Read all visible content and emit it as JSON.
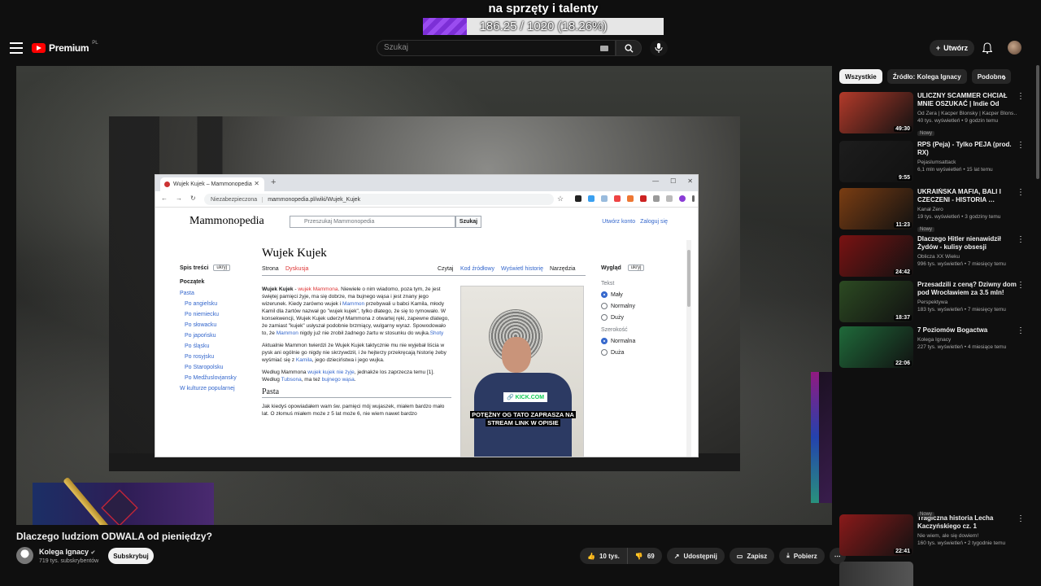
{
  "overlay": {
    "goal_title": "na sprzęty i talenty",
    "progress_text": "186.25 / 1020 (18.26%)",
    "progress_fraction": 0.1826,
    "accent": "#8c3be6"
  },
  "header": {
    "logo_text": "Premium",
    "logo_region": "PL",
    "search_placeholder": "Szukaj",
    "create_label": "Utwórz"
  },
  "browser": {
    "tab_title": "Wujek Kujek – Mammonopedia",
    "insecure_label": "Niezabezpieczona",
    "url": "mammonopedia.pl/wiki/Wujek_Kujek"
  },
  "wiki": {
    "logo": "Mammonopedia",
    "search_placeholder": "Przeszukaj Mammonopedia",
    "search_btn": "Szukaj",
    "create_account": "Utwórz konto",
    "login": "Zaloguj się",
    "toc_title": "Spis treści",
    "hide": "ukryj",
    "toc": [
      {
        "label": "Początek",
        "level": "top"
      },
      {
        "label": "Pasta",
        "level": "main"
      },
      {
        "label": "Po angielsku",
        "level": "sub"
      },
      {
        "label": "Po niemiecku",
        "level": "sub"
      },
      {
        "label": "Po słowacku",
        "level": "sub"
      },
      {
        "label": "Po japońsku",
        "level": "sub"
      },
      {
        "label": "Po śląsku",
        "level": "sub"
      },
      {
        "label": "Po rosyjsku",
        "level": "sub"
      },
      {
        "label": "Po Staropolsku",
        "level": "sub"
      },
      {
        "label": "Po Medžuslovjansky",
        "level": "sub"
      },
      {
        "label": "W kulturze popularnej",
        "level": "main"
      }
    ],
    "title": "Wujek Kujek",
    "tab_page": "Strona",
    "tab_discussion": "Dyskusja",
    "tab_read": "Czytaj",
    "tab_source": "Kod źródłowy",
    "tab_history": "Wyświetl historię",
    "tab_tools": "Narzędzia",
    "para1_a": "Wujek Kujek",
    "para1_b": " - ",
    "para1_c": "wujek Mammona",
    "para1_d": ". Niewiele o nim wiadomo, poza tym, że jest świętej pamięci żyje, ma się dobrze, ma bujnego wąsa i jest znany jego wizerunek. Kiedy zarówno wujek i ",
    "para1_e": "Mammon",
    "para1_f": " przebywali u babci Kamila, młody Kamil dla żartów nazwał go \"wujek kujek\", tylko dlatego, że się to rymowało. W konsekwencji, Wujek Kujek uderzył Mammona z otwartej ręki, zapewne dlatego, że zamiast \"kujek\" usłyszał podobnie brzmiący, wulgarny wyraz. Spowodowało to, że ",
    "para1_g": "Mammon",
    "para1_h": " nigdy już nie zrobił żadnego żartu w stosunku do wujka.",
    "para1_i": "Shoty",
    "para2": "Aktualnie Mammon twierdzi że Wujek Kujek taktycznie mu nie wyjebał liścia w pysk ani ogólnie go nigdy nie skrzywdził, i że hejterzy przekręcają historię żeby wyśmiać się z ",
    "para2_link": "Kamila",
    "para2_end": ", jego dzieciństwa i jego wujka.",
    "para3_a": "Według Mammona ",
    "para3_link": "wujek kujek nie żyje",
    "para3_b": ", jednakże los zaprzecza temu [1]. Według ",
    "para3_link2": "Tubsona",
    "para3_c": ", ma też ",
    "para3_link3": "bujnego wąsa",
    "para3_d": ".",
    "section_pasta": "Pasta",
    "pasta_text": "Jak kiedyś opowiadałem wam św. pamięci mój wujaszek, miałem bardzo mało lat. O złomuś miałem może z 5 lat może 6, nie wiem nawet bardzo",
    "img_tag": "KICK.COM",
    "img_promo_1": "POTĘŻNY OG TATO ZAPRASZA NA",
    "img_promo_2": "STREAM LINK W OPISIE",
    "appearance_title": "Wygląd",
    "text_label": "Tekst",
    "text_opts": [
      "Mały",
      "Normalny",
      "Duży"
    ],
    "width_label": "Szerokość",
    "width_opts": [
      "Normalna",
      "Duża"
    ]
  },
  "video": {
    "title": "Dlaczego ludziom ODWALA od pieniędzy?",
    "channel": "Kolega Ignacy",
    "subs": "719 tys. subskrybentów",
    "subscribe": "Subskrybuj",
    "likes": "10 tys.",
    "dislikes": "69",
    "share": "Udostępnij",
    "save": "Zapisz",
    "download": "Pobierz"
  },
  "chips": [
    "Wszystkie",
    "Źródło: Kolega Ignacy",
    "Podobne"
  ],
  "recommendations": [
    {
      "title": "ULICZNY SCAMMER CHCIAŁ MNIE OSZUKAĆ | Indie Od Zer…",
      "channel": "Od Zera | Kacper Blonsky | Kacper Blons…",
      "stats": "40 tys. wyświetleń • 9 godzin temu",
      "badge": "Nowy",
      "duration": "49:30",
      "color": "#b33a2a"
    },
    {
      "title": "RPS (Peja) - Tylko PEJA (prod. RX)",
      "channel": "Pejaslumsattack",
      "stats": "6,1 mln wyświetleń • 15 lat temu",
      "badge": "",
      "duration": "9:55",
      "color": "#1d1d1d"
    },
    {
      "title": "UKRAIŃSKA MAFIA, BALI I CZECZENI - HISTORIA …",
      "channel": "Kanał Zero",
      "stats": "19 tys. wyświetleń • 3 godziny temu",
      "badge": "Nowy",
      "duration": "11:23",
      "color": "#7a3d12"
    },
    {
      "title": "Dlaczego Hitler nienawidził Żydów - kulisy obsesji",
      "channel": "Oblicza XX Wieku",
      "stats": "996 tys. wyświetleń • 7 miesięcy temu",
      "badge": "",
      "duration": "24:42",
      "color": "#7a1212"
    },
    {
      "title": "Przesadzili z ceną? Dziwny dom pod Wrocławiem za 3.5 mln!",
      "channel": "Perspektywa",
      "stats": "183 tys. wyświetleń • 7 miesięcy temu",
      "badge": "",
      "duration": "18:37",
      "color": "#2c4a22"
    },
    {
      "title": "7 Poziomów Bogactwa",
      "channel": "Kolega Ignacy",
      "stats": "227 tys. wyświetleń • 4 miesiące temu",
      "badge": "",
      "duration": "22:06",
      "color": "#1f6a3a"
    },
    {
      "title": "Tragiczna historia Lecha Kaczyńskiego cz. 1",
      "channel": "Nie wiem, ale się dowiem!",
      "stats": "160 tys. wyświetleń • 2 tygodnie temu",
      "badge": "",
      "duration": "22:41",
      "color": "#8a1a1a"
    }
  ],
  "partial_rec_badge": "Nowy"
}
